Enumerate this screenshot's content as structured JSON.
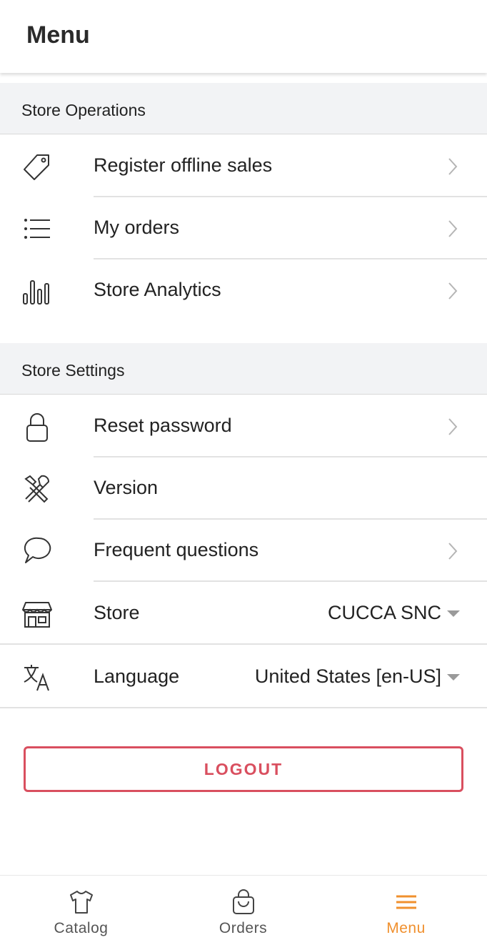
{
  "header": {
    "title": "Menu"
  },
  "sections": [
    {
      "title": "Store Operations",
      "items": [
        {
          "label": "Register offline sales",
          "icon": "tag-icon"
        },
        {
          "label": "My orders",
          "icon": "list-icon"
        },
        {
          "label": "Store Analytics",
          "icon": "bar-chart-icon"
        }
      ]
    },
    {
      "title": "Store Settings",
      "items": [
        {
          "label": "Reset password",
          "icon": "lock-icon"
        },
        {
          "label": "Version",
          "icon": "tools-icon"
        },
        {
          "label": "Frequent questions",
          "icon": "chat-bubble-icon"
        },
        {
          "label": "Store",
          "icon": "storefront-icon",
          "value": "CUCCA SNC"
        },
        {
          "label": "Language",
          "icon": "translate-icon",
          "value": "United States [en-US]"
        }
      ]
    }
  ],
  "logout_label": "LOGOUT",
  "tabs": [
    {
      "label": "Catalog",
      "icon": "tshirt-icon",
      "active": false
    },
    {
      "label": "Orders",
      "icon": "shopping-bag-icon",
      "active": false
    },
    {
      "label": "Menu",
      "icon": "hamburger-icon",
      "active": true
    }
  ],
  "colors": {
    "accent": "#f0902e",
    "logout": "#d94f5f",
    "section_bg": "#f2f3f5"
  }
}
